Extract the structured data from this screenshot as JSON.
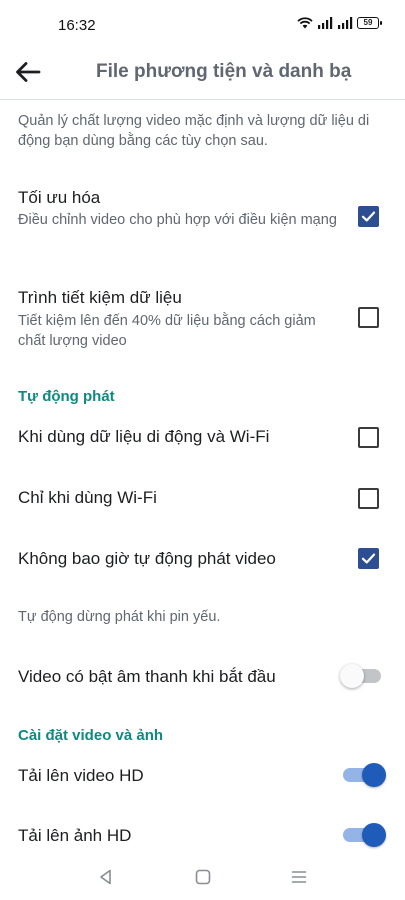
{
  "status_bar": {
    "time": "16:32",
    "battery": "59"
  },
  "header": {
    "title": "File phương tiện và danh bạ",
    "back_icon": "arrow-left-icon"
  },
  "intro": "Quản lý chất lượng video mặc định và lượng dữ liệu di động bạn dùng bằng các tùy chọn sau.",
  "settings": {
    "optimize": {
      "title": "Tối ưu hóa",
      "subtitle": "Điều chỉnh video cho phù hợp với điều kiện mạng",
      "checked": true
    },
    "data_saver": {
      "title": "Trình tiết kiệm dữ liệu",
      "subtitle": "Tiết kiệm lên đến 40% dữ liệu bằng cách giảm chất lượng video",
      "checked": false
    }
  },
  "autoplay": {
    "section_title": "Tự động phát",
    "options": [
      {
        "label": "Khi dùng dữ liệu di động và Wi-Fi",
        "checked": false
      },
      {
        "label": "Chỉ khi dùng Wi-Fi",
        "checked": false
      },
      {
        "label": "Không bao giờ tự động phát video",
        "checked": true
      }
    ],
    "note": "Tự động dừng phát khi pin yếu."
  },
  "sound": {
    "label": "Video có bật âm thanh khi bắt đầu",
    "on": false
  },
  "video_photo": {
    "section_title": "Cài đặt video và ảnh",
    "upload_hd_video": {
      "label": "Tải lên video HD",
      "on": true
    },
    "upload_hd_photo": {
      "label": "Tải lên ảnh HD",
      "on": true
    }
  },
  "colors": {
    "accent": "#2d4f92",
    "section": "#0e8a80",
    "toggle_on": "#1f5bb8"
  }
}
